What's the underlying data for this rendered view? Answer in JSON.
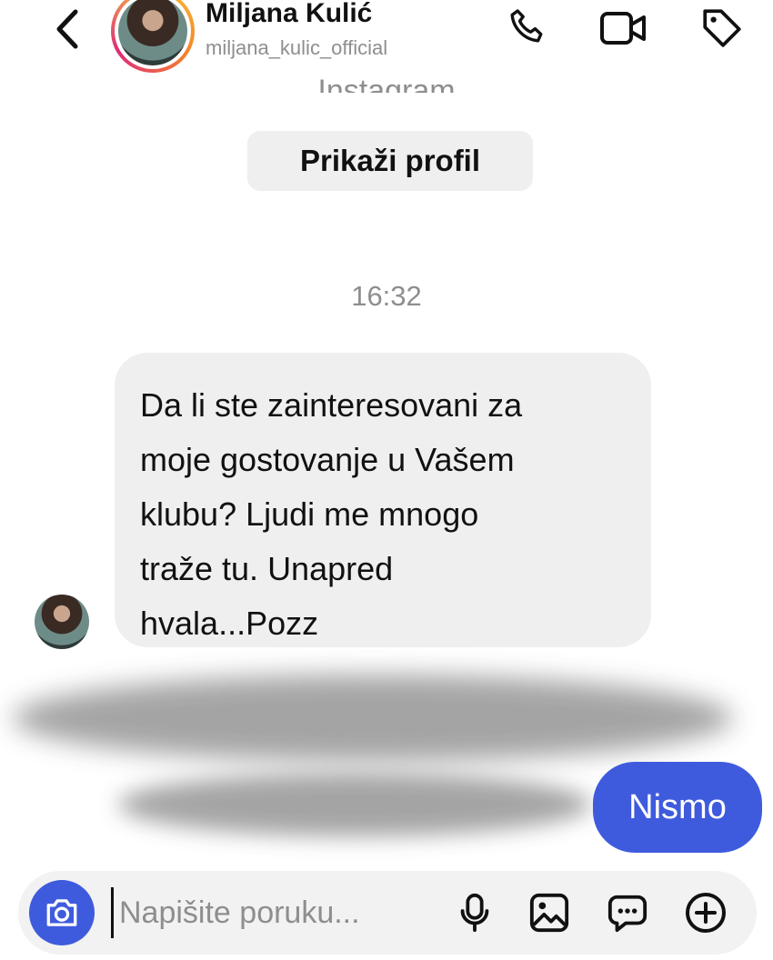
{
  "header": {
    "name": "Miljana Kulić",
    "handle": "miljana_kulic_official"
  },
  "chat": {
    "partial_label": "Instagram",
    "view_profile_label": "Prikaži profil",
    "timestamp": "16:32",
    "incoming_message_lines": [
      "Da li ste zainteresovani za",
      "moje gostovanje u Vašem",
      "klubu? Ljudi me mnogo",
      "traže tu. Unapred",
      "hvala...Pozz"
    ],
    "outgoing_message": "Nismo"
  },
  "composer": {
    "placeholder": "Napišite poruku..."
  },
  "icons": {
    "back": "chevron-left-icon",
    "call": "phone-icon",
    "video": "video-camera-icon",
    "tag": "tag-icon",
    "camera": "camera-icon",
    "mic": "microphone-icon",
    "gallery": "image-icon",
    "sticker": "chat-bubble-icon",
    "more": "plus-circle-icon"
  },
  "colors": {
    "accent": "#3f5bdd",
    "bubble_incoming": "#efefef",
    "muted_text": "#8e8e8e"
  }
}
